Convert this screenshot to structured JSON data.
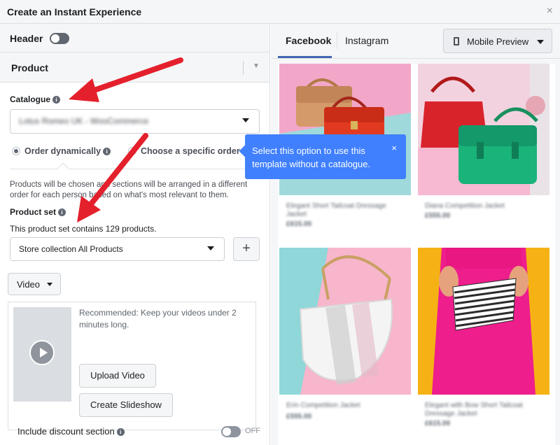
{
  "window": {
    "title": "Create an Instant Experience",
    "close_icon": "×"
  },
  "left": {
    "header_label": "Header",
    "product_label": "Product",
    "catalogue": {
      "label": "Catalogue",
      "value": "Lotus Romeo UK - WooCommerce"
    },
    "order": {
      "dynamic_label": "Order dynamically",
      "specific_label": "Choose a specific order"
    },
    "order_description": "Products will be chosen and sections will be arranged in a different order for each person based on what's most relevant to them.",
    "product_set": {
      "label": "Product set",
      "count_text": "This product set contains 129 products.",
      "value": "Store collection All Products",
      "add_label": "+"
    },
    "video": {
      "dropdown_label": "Video",
      "recommendation": "Recommended: Keep your videos under 2 minutes long.",
      "upload_label": "Upload Video",
      "slideshow_label": "Create Slideshow"
    },
    "discount": {
      "label": "Include discount section",
      "state": "OFF"
    }
  },
  "right": {
    "tabs": [
      {
        "label": "Facebook"
      },
      {
        "label": "Instagram"
      }
    ],
    "preview_label": "Mobile Preview",
    "products": [
      {
        "name": "Elegant Short Tailcoat Dressage Jacket",
        "price": "£615.00"
      },
      {
        "name": "Diana Competition Jacket",
        "price": "£555.00"
      },
      {
        "name": "Erin Competition Jacket",
        "price": "£555.00"
      },
      {
        "name": "Elegant with Bow Short Tailcoat Dressage Jacket",
        "price": "£615.00"
      }
    ]
  },
  "tooltip": {
    "text": "Select this option to use this template without a catalogue.",
    "close": "×"
  },
  "colors": {
    "accent": "#4267b2",
    "tooltip": "#4080ff",
    "arrow": "#e4202c"
  }
}
